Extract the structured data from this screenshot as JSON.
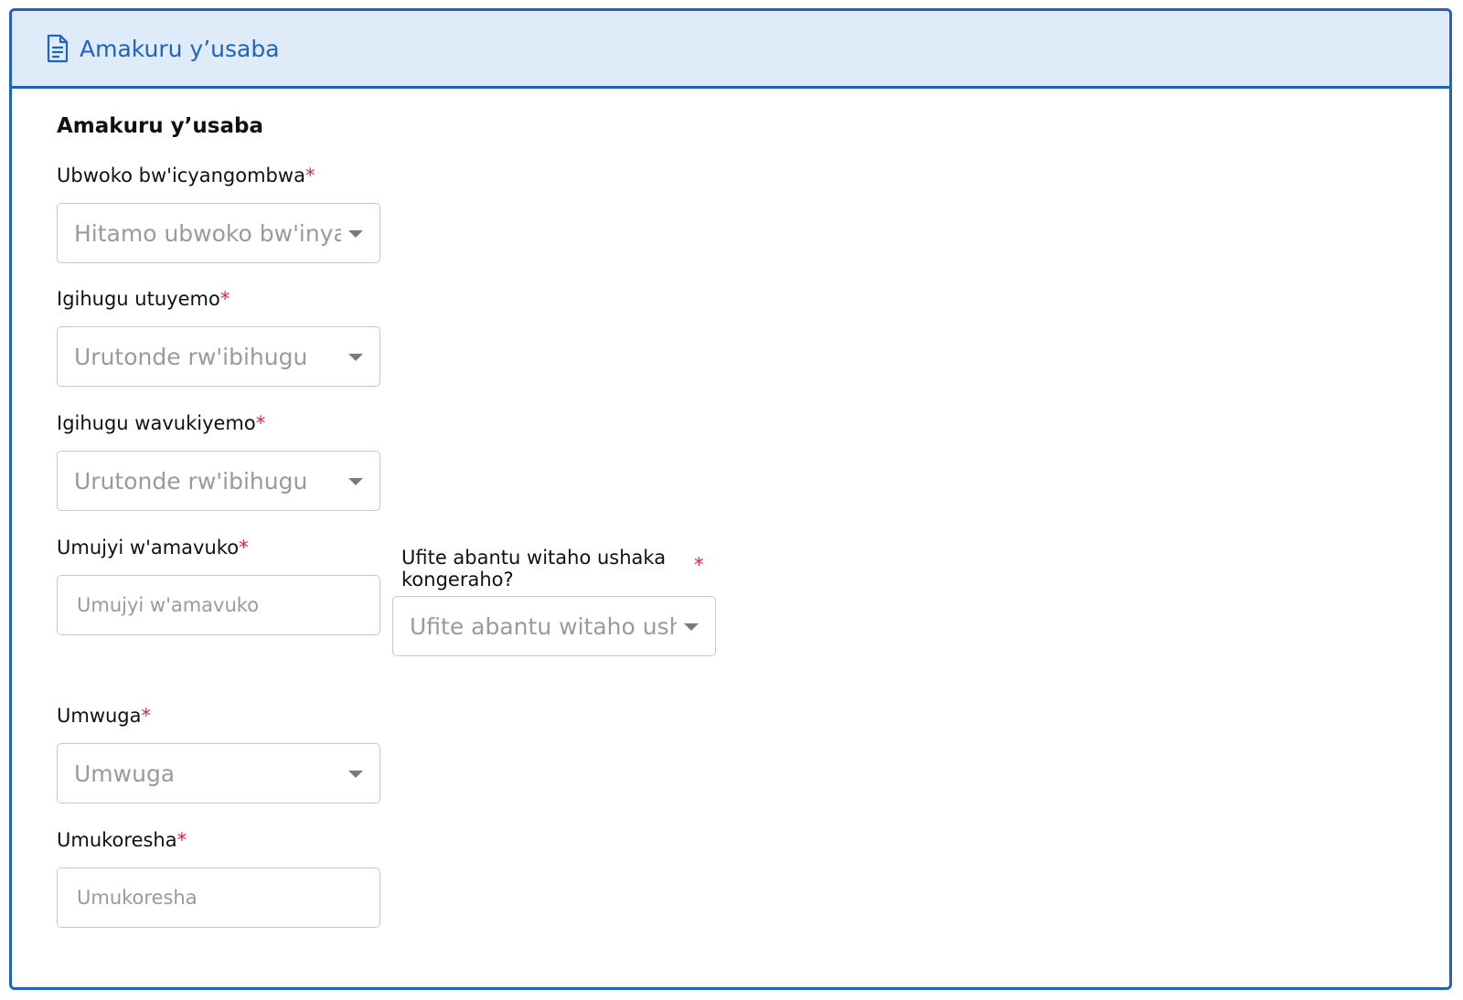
{
  "header": {
    "title": "Amakuru y’usaba",
    "icon": "document-icon",
    "accent_color": "#1f63c2",
    "background_color": "#dfebf8"
  },
  "section": {
    "title": "Amakuru y’usaba"
  },
  "required_marker": "*",
  "fields": {
    "visa_type": {
      "label": "Ubwoko bw'icyangombwa",
      "placeholder": "Hitamo ubwoko bw'inyandiko"
    },
    "residence_country": {
      "label": "Igihugu utuyemo",
      "placeholder": "Urutonde rw'ibihugu"
    },
    "birth_country": {
      "label": "Igihugu wavukiyemo",
      "placeholder": "Urutonde rw'ibihugu"
    },
    "birth_city": {
      "label": "Umujyi w'amavuko",
      "placeholder": "Umujyi w'amavuko"
    },
    "additional_people": {
      "label": "Ufite abantu witaho ushaka kongeraho?",
      "placeholder": "Ufite abantu witaho ushaka kongeraho?"
    },
    "occupation": {
      "label": "Umwuga",
      "placeholder": "Umwuga"
    },
    "employer": {
      "label": "Umukoresha",
      "placeholder": "Umukoresha"
    }
  }
}
